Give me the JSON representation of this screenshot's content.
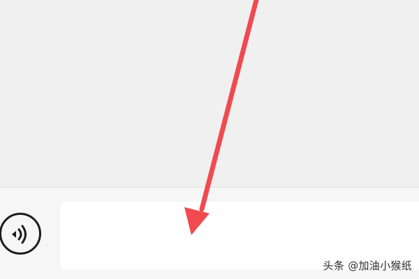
{
  "input": {
    "value": "",
    "placeholder": ""
  },
  "voice_button": {
    "icon": "voice-icon"
  },
  "annotation": {
    "type": "arrow",
    "color": "#f04a4f"
  },
  "watermark": {
    "text": "头条 @加油小猴纸"
  },
  "colors": {
    "chat_background": "#f0f0f0",
    "input_bar_background": "#f6f6f6",
    "input_background": "#ffffff",
    "arrow": "#f04a4f"
  }
}
